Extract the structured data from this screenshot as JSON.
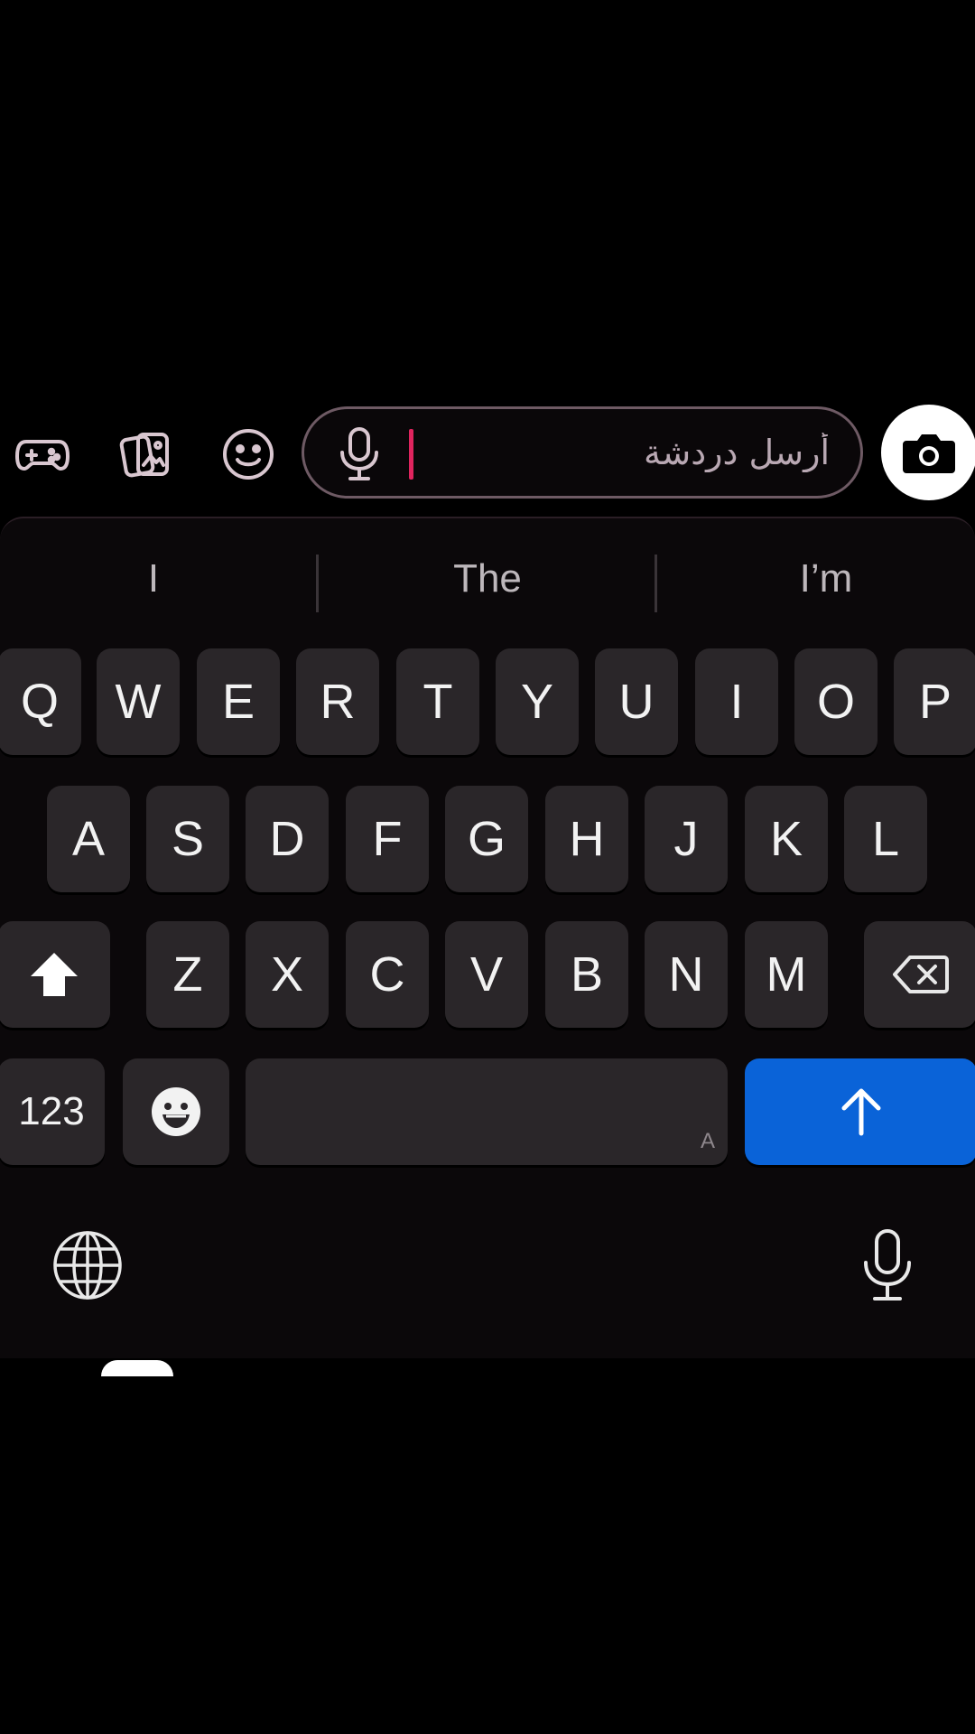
{
  "chat_bar": {
    "icons": [
      "game-controller-icon",
      "photo-cards-icon",
      "smiley-icon"
    ],
    "input_placeholder": "أرسل دردشة",
    "input_value": "",
    "mic_icon": "microphone-icon",
    "camera_icon": "camera-icon",
    "caret_color": "#e0245e"
  },
  "keyboard": {
    "suggestions": [
      "I",
      "The",
      "I’m"
    ],
    "row1": [
      "Q",
      "W",
      "E",
      "R",
      "T",
      "Y",
      "U",
      "I",
      "O",
      "P"
    ],
    "row2": [
      "A",
      "S",
      "D",
      "F",
      "G",
      "H",
      "J",
      "K",
      "L"
    ],
    "row3": [
      "Z",
      "X",
      "C",
      "V",
      "B",
      "N",
      "M"
    ],
    "mode_key_label": "123",
    "space_hint": "A",
    "enter_color": "#0a63d8",
    "icons": {
      "shift": "shift-arrow-icon",
      "delete": "backspace-icon",
      "emoji": "emoji-icon",
      "enter": "up-arrow-icon",
      "globe": "globe-icon",
      "dictation": "microphone-icon"
    }
  }
}
